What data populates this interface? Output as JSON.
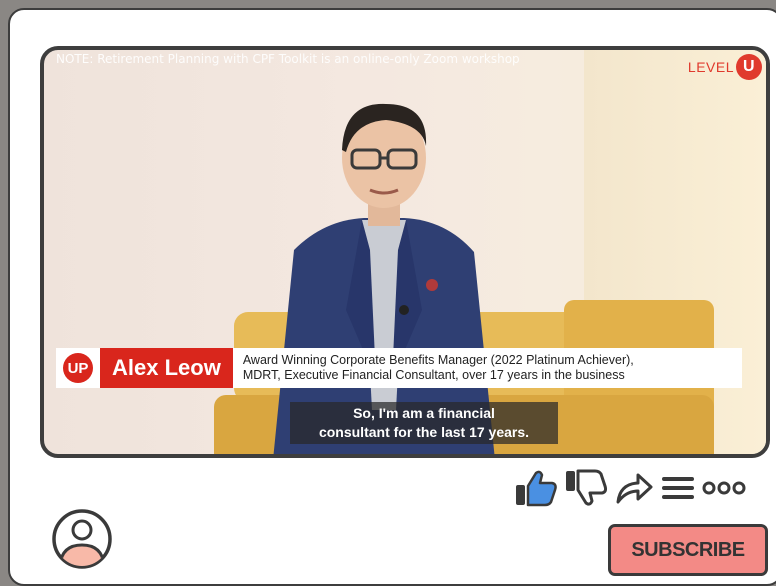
{
  "video": {
    "notice": "NOTE: Retirement Planning with CPF Toolkit is an online-only Zoom workshop",
    "brand_text": "LEVEL",
    "brand_badge": "U",
    "lower_third": {
      "logo": "UP",
      "name": "Alex Leow",
      "description_line1": "Award Winning Corporate Benefits Manager (2022 Platinum Achiever),",
      "description_line2": "MDRT, Executive Financial Consultant, over 17 years in the business"
    },
    "caption_line1": "So, I'm am a financial",
    "caption_line2": "consultant for the last 17 years."
  },
  "actions": {
    "icons": [
      "thumbs-up-icon",
      "thumbs-down-icon",
      "share-icon",
      "menu-icon",
      "more-icon"
    ],
    "like_color": "#4a90e2",
    "icon_color": "#3a3a3a"
  },
  "channel": {
    "avatar_icon": "user-avatar-icon",
    "avatar_color": "#f8b9a8"
  },
  "subscribe": {
    "label": "SUBSCRIBE",
    "color": "#f38a86"
  }
}
